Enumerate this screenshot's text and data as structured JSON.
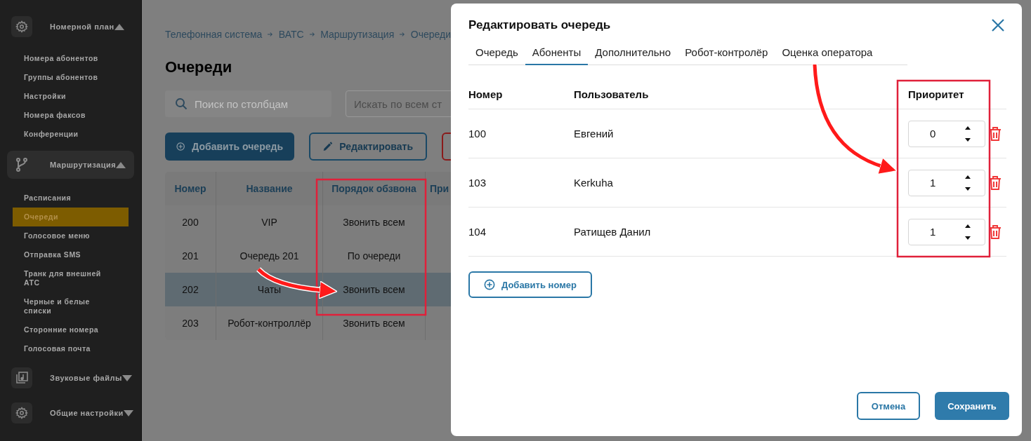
{
  "sidebar": {
    "groups": [
      {
        "label": "Номерной план",
        "expanded": true,
        "selected": false,
        "items": [
          {
            "label": "Номера абонентов",
            "selected": false
          },
          {
            "label": "Группы абонентов",
            "selected": false
          },
          {
            "label": "Настройки",
            "selected": false
          },
          {
            "label": "Номера факсов",
            "selected": false
          },
          {
            "label": "Конференции",
            "selected": false
          }
        ]
      },
      {
        "label": "Маршрутизация",
        "expanded": true,
        "selected": true,
        "items": [
          {
            "label": "Расписания",
            "selected": false
          },
          {
            "label": "Очереди",
            "selected": true
          },
          {
            "label": "Голосовое меню",
            "selected": false
          },
          {
            "label": "Отправка SMS",
            "selected": false
          },
          {
            "label": "Транк для внешней АТС",
            "selected": false
          },
          {
            "label": "Черные и белые списки",
            "selected": false
          },
          {
            "label": "Сторонние номера",
            "selected": false
          },
          {
            "label": "Голосовая почта",
            "selected": false
          }
        ]
      },
      {
        "label": "Звуковые файлы",
        "expanded": false,
        "selected": false
      },
      {
        "label": "Общие настройки",
        "expanded": false,
        "selected": false
      }
    ]
  },
  "breadcrumb": [
    "Телефонная система",
    "ВАТС",
    "Маршрутизация",
    "Очереди"
  ],
  "page_title": "Очереди",
  "column_search": {
    "placeholder": "Поиск по столбцам"
  },
  "global_search": {
    "placeholder": "Искать по всем ст"
  },
  "toolbar": {
    "add_button": "Добавить очередь",
    "edit_button": "Редактировать"
  },
  "table": {
    "columns": [
      "Номер",
      "Название",
      "Порядок обзвона",
      "При"
    ],
    "rows": [
      {
        "cells": [
          "200",
          "VIP",
          "Звонить всем"
        ],
        "selected": false
      },
      {
        "cells": [
          "201",
          "Очередь 201",
          "По очереди"
        ],
        "selected": false
      },
      {
        "cells": [
          "202",
          "Чаты",
          "Звонить всем"
        ],
        "selected": true
      },
      {
        "cells": [
          "203",
          "Робот-контроллёр",
          "Звонить всем"
        ],
        "selected": false
      }
    ]
  },
  "dialog": {
    "title": "Редактировать очередь",
    "tabs": [
      {
        "label": "Очередь",
        "selected": false
      },
      {
        "label": "Абоненты",
        "selected": true
      },
      {
        "label": "Дополнительно",
        "selected": false
      },
      {
        "label": "Робот-контролёр",
        "selected": false
      },
      {
        "label": "Оценка оператора",
        "selected": false
      }
    ],
    "columns": [
      "Номер",
      "Пользователь",
      "Приоритет"
    ],
    "rows": [
      {
        "number": "100",
        "user": "Евгений",
        "priority": "0"
      },
      {
        "number": "103",
        "user": "Kerkuha",
        "priority": "1"
      },
      {
        "number": "104",
        "user": "Ратищев Данил",
        "priority": "1"
      }
    ],
    "add_button": "Добавить номер",
    "cancel_button": "Отмена",
    "save_button": "Сохранить"
  }
}
